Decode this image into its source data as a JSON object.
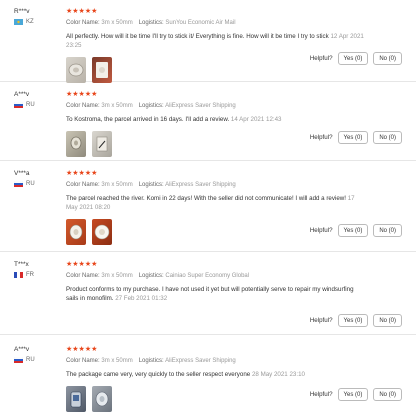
{
  "labels": {
    "color": "Color Name:",
    "logistics": "Logistics:",
    "helpful": "Helpful?"
  },
  "reviews": [
    {
      "user": "R***v",
      "country": "KZ",
      "stars": "★★★★★",
      "color": "3m x 50mm",
      "logistics": "SunYou Economic Air Mail",
      "text": "All perfectly. How will it be time I'll try to stick it/ Everything is fine. How will it be time I try to stick",
      "date": "12 Apr 2021 23:25",
      "yes": "Yes (0)",
      "no": "No (0)",
      "photo_count": 2
    },
    {
      "user": "A***v",
      "country": "RU",
      "stars": "★★★★★",
      "color": "3m x 50mm",
      "logistics": "AliExpress Saver Shipping",
      "text": "To Kostroma, the parcel arrived in 16 days. I'll add a review.",
      "date": "14 Apr 2021 12:43",
      "yes": "Yes (0)",
      "no": "No (0)",
      "photo_count": 2
    },
    {
      "user": "V***a",
      "country": "RU",
      "stars": "★★★★★",
      "color": "3m x 50mm",
      "logistics": "AliExpress Saver Shipping",
      "text": "The parcel reached the river. Komi in 22 days! With the seller did not communicate! I will add a review!",
      "date": "17 May 2021 08:20",
      "yes": "Yes (0)",
      "no": "No (0)",
      "photo_count": 2
    },
    {
      "user": "T***x",
      "country": "FR",
      "stars": "★★★★★",
      "color": "3m x 50mm",
      "logistics": "Cainiao Super Economy Global",
      "text": "Product conforms to my purchase. I have not used it yet but will potentially serve to repair my windsurfing sails in monofilm.",
      "date": "27 Feb 2021 01:32",
      "yes": "Yes (0)",
      "no": "No (0)",
      "photo_count": 0
    },
    {
      "user": "A***v",
      "country": "RU",
      "stars": "★★★★★",
      "color": "3m x 50mm",
      "logistics": "AliExpress Saver Shipping",
      "text": "The package came very, very quickly to the seller respect everyone",
      "date": "28 May 2021 23:10",
      "yes": "Yes (0)",
      "no": "No (0)",
      "photo_count": 2
    }
  ]
}
